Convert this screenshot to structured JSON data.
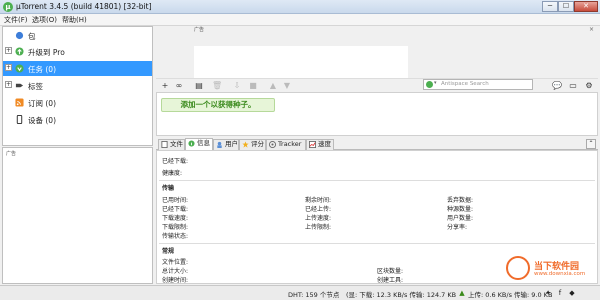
{
  "window": {
    "title": "µTorrent 3.4.5  (build 41801) [32-bit]",
    "app_icon": "utorrent-icon",
    "min": "─",
    "max": "☐",
    "close": "✕"
  },
  "menu": [
    "文件(F)",
    "选项(O)",
    "帮助(H)"
  ],
  "sidebar": {
    "items": [
      {
        "label": "包",
        "icon": "bundle-icon",
        "expander": ""
      },
      {
        "label": "升级到 Pro",
        "icon": "pro-icon",
        "expander": "+"
      },
      {
        "label": "任务 (0)",
        "icon": "torrents-icon",
        "expander": "+"
      },
      {
        "label": "标签",
        "icon": "label-icon",
        "expander": "+"
      },
      {
        "label": "订阅 (0)",
        "icon": "rss-icon",
        "expander": ""
      },
      {
        "label": "设备 (0)",
        "icon": "device-icon",
        "expander": ""
      }
    ],
    "ad_label": "广告"
  },
  "ad": {
    "label": "广告",
    "close": "×"
  },
  "toolbar": {
    "buttons": [
      {
        "icon": "add-icon",
        "glyph": "+"
      },
      {
        "icon": "add-link-icon",
        "glyph": "∞"
      },
      {
        "icon": "create-torrent-icon",
        "glyph": "▤"
      },
      {
        "icon": "delete-icon",
        "glyph": "🗑"
      },
      {
        "icon": "start-icon",
        "glyph": "⇩"
      },
      {
        "icon": "stop-icon",
        "glyph": "■"
      },
      {
        "icon": "up-icon",
        "glyph": "▲"
      },
      {
        "icon": "down-icon",
        "glyph": "▼"
      }
    ],
    "search_placeholder": "Antispace Search",
    "search_caret": "▾",
    "right_buttons": [
      {
        "icon": "chat-icon",
        "glyph": "💬"
      },
      {
        "icon": "remote-icon",
        "glyph": "▭"
      },
      {
        "icon": "settings-icon",
        "glyph": "⚙"
      }
    ]
  },
  "torrent_list": {
    "hint": "添加一个以获得种子。"
  },
  "tabs": [
    {
      "label": "文件",
      "icon": "file-icon"
    },
    {
      "label": "信息",
      "icon": "info-icon"
    },
    {
      "label": "用户",
      "icon": "peers-icon"
    },
    {
      "label": "评分",
      "icon": "ratings-icon"
    },
    {
      "label": "Tracker",
      "icon": "tracker-icon"
    },
    {
      "label": "速度",
      "icon": "speed-icon"
    }
  ],
  "tabs_collapse": "⌃",
  "detail": {
    "downloaded": "已经下载:",
    "availability": "健康度:",
    "transfer_title": "传输",
    "col1": [
      "已用时间:",
      "已经下载:",
      "下载速度:",
      "下载限制:",
      "传输状态:"
    ],
    "col2": [
      "剩余时间:",
      "已经上传:",
      "上传速度:",
      "上传限制:"
    ],
    "col3": [
      "丢弃数据:",
      "种源数量:",
      "用户数量:",
      "分享率:"
    ],
    "general_title": "常规",
    "gen1": [
      "文件位置:",
      "总计大小:",
      "创建时间:"
    ],
    "gen2": [
      "区块数量:",
      "创建工具:"
    ]
  },
  "status": {
    "dht": "DHT: 159 个节点",
    "down": "(显: 下载: 12.3 KB/s 传输: 124.7 KB",
    "up": "上传: 0.6 KB/s 传输: 9.0 KB"
  },
  "watermark": {
    "line1": "当下软件园",
    "line2": "www.downxia.com"
  }
}
